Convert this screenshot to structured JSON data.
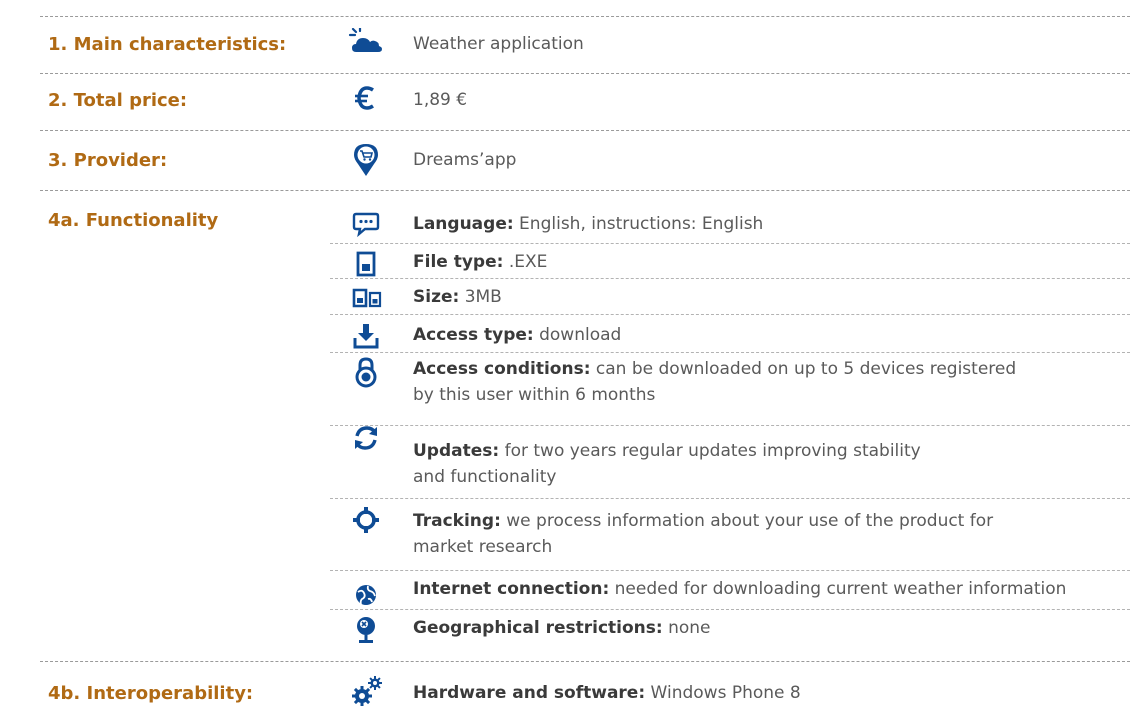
{
  "colors": {
    "label": "#b06a14",
    "icon": "#0f4c95",
    "text": "#5a5a5a",
    "divider": "#9a9a9a"
  },
  "rows": [
    {
      "label": "1. Main characteristics:",
      "icon": "weather-icon",
      "value": "Weather application"
    },
    {
      "label": "2. Total price:",
      "icon": "euro-icon",
      "value": "1,89 €"
    },
    {
      "label": "3. Provider:",
      "icon": "shop-location-icon",
      "value": "Dreams’app"
    }
  ],
  "functionality": {
    "label": "4a. Functionality",
    "items": [
      {
        "icon": "speech-bubble-icon",
        "key": "Language:",
        "value": " English, instructions: English"
      },
      {
        "icon": "file-icon",
        "key": "File type:",
        "value": " .EXE"
      },
      {
        "icon": "file-size-icon",
        "key": "Size:",
        "value": " 3MB"
      },
      {
        "icon": "download-icon",
        "key": "Access type:",
        "value": " download"
      },
      {
        "icon": "padlock-icon",
        "key": "Access conditions:",
        "value": " can be downloaded on up to 5 devices registered",
        "value2": "by this user within 6 months"
      },
      {
        "icon": "refresh-icon",
        "key": "Updates:",
        "value": " for two years regular updates improving stability",
        "value2": "and functionality"
      },
      {
        "icon": "crosshair-icon",
        "key": "Tracking:",
        "value": " we process information about your use of the product for",
        "value2": "market research"
      },
      {
        "icon": "globe-icon",
        "key": "Internet connection:",
        "value": " needed for downloading current weather information"
      },
      {
        "icon": "globe-restriction-icon",
        "key": "Geographical restrictions:",
        "value": " none"
      }
    ]
  },
  "interoperability": {
    "label": "4b. Interoperability:",
    "icon": "gears-icon",
    "key": "Hardware and software:",
    "value": " Windows Phone 8"
  }
}
